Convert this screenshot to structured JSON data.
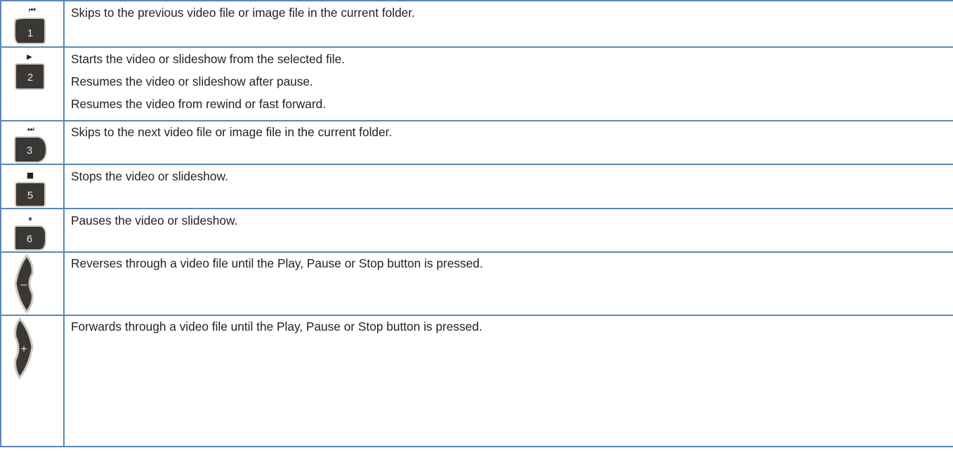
{
  "colors": {
    "border": "#5b87b6",
    "key_fill": "#3a3836",
    "key_edge": "#cfcac0",
    "text": "#231f20"
  },
  "rows": [
    {
      "key": {
        "number": "1",
        "symbol": "⏮",
        "icon": "skip-previous-icon"
      },
      "lines": [
        "Skips to the previous video file or image file in the current folder."
      ]
    },
    {
      "key": {
        "number": "2",
        "symbol": "▶",
        "icon": "play-icon"
      },
      "lines": [
        "Starts the video or slideshow from the selected file.",
        "Resumes the video or slideshow after pause.",
        "Resumes the video from rewind or fast forward."
      ]
    },
    {
      "key": {
        "number": "3",
        "symbol": "⏭",
        "icon": "skip-next-icon"
      },
      "lines": [
        "Skips to the next video file or image file in the current folder."
      ]
    },
    {
      "key": {
        "number": "5",
        "symbol": "■",
        "icon": "stop-icon"
      },
      "lines": [
        "Stops the video or slideshow."
      ]
    },
    {
      "key": {
        "number": "6",
        "symbol": "⏸",
        "icon": "pause-icon"
      },
      "lines": [
        "Pauses the video or slideshow."
      ]
    },
    {
      "key": {
        "number": "–",
        "symbol": "",
        "icon": "minus-icon"
      },
      "lines": [
        "Reverses through a video file until the Play, Pause or Stop button is pressed."
      ]
    },
    {
      "key": {
        "number": "+",
        "symbol": "",
        "icon": "plus-icon"
      },
      "lines": [
        "Forwards through a video file until the Play, Pause or Stop button is pressed."
      ]
    }
  ]
}
